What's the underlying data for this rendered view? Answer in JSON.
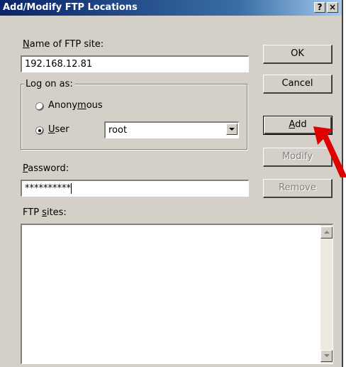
{
  "window": {
    "title": "Add/Modify FTP Locations",
    "help_label": "?",
    "close_label": "×"
  },
  "site_name": {
    "label_prefix": "",
    "label_key": "N",
    "label_rest": "ame of FTP site:",
    "value": "192.168.12.81"
  },
  "logon": {
    "group_label": "Log on as:",
    "anonymous": {
      "label_pre": "Anony",
      "label_key": "m",
      "label_post": "ous",
      "selected": false
    },
    "user": {
      "label_pre": "",
      "label_key": "U",
      "label_post": "ser",
      "selected": true
    },
    "user_value": "root"
  },
  "password": {
    "label_key": "P",
    "label_rest": "assword:",
    "value": "**********"
  },
  "ftp_sites": {
    "label_pre": "FTP ",
    "label_key": "s",
    "label_post": "ites:"
  },
  "buttons": {
    "ok": "OK",
    "cancel": "Cancel",
    "add_key": "A",
    "add_rest": "dd",
    "modify": "Modify",
    "remove": "Remove"
  },
  "icons": {
    "help": "help-icon",
    "close": "close-icon",
    "dropdown": "chevron-down-icon",
    "scroll_up": "scroll-up-icon",
    "scroll_down": "scroll-down-icon",
    "annotation": "red-arrow-icon"
  },
  "colors": {
    "titlebar": "#0a246a",
    "dialog_bg": "#d4d0c8",
    "annotation_arrow": "#e00000"
  }
}
